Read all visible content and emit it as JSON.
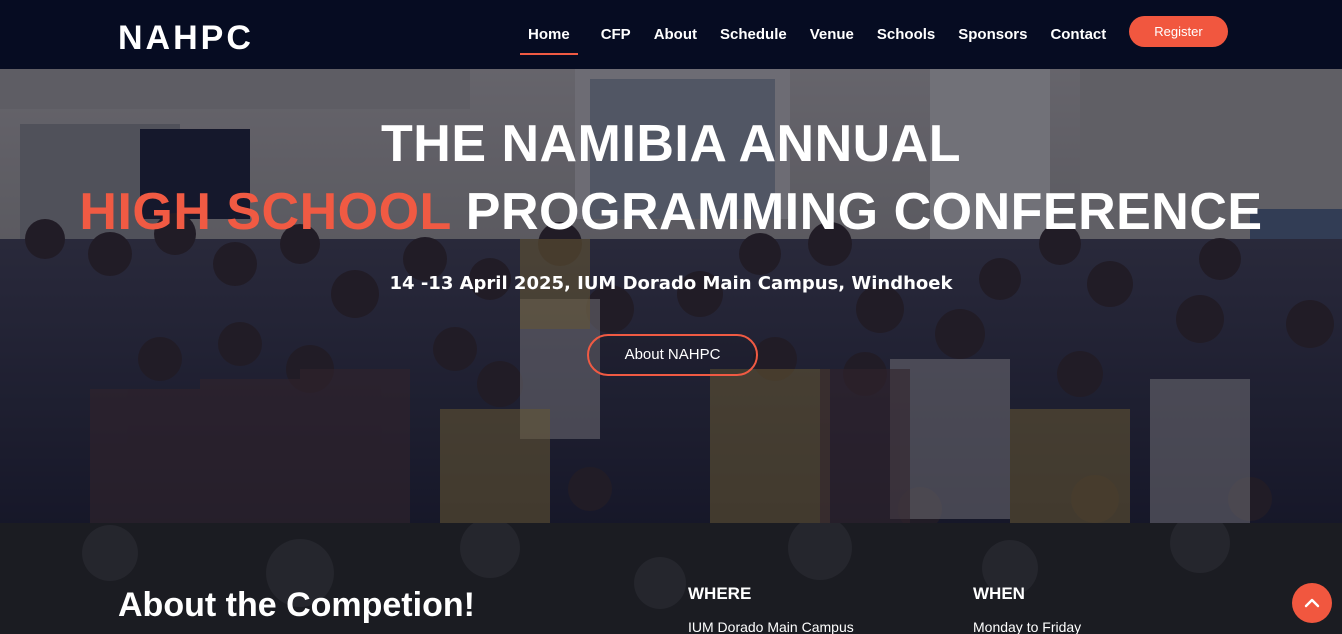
{
  "header": {
    "logo": "NAHPC",
    "nav": [
      {
        "label": "Home",
        "active": true
      },
      {
        "label": "CFP"
      },
      {
        "label": "About"
      },
      {
        "label": "Schedule"
      },
      {
        "label": "Venue"
      },
      {
        "label": "Schools"
      },
      {
        "label": "Sponsors"
      },
      {
        "label": "Contact"
      }
    ],
    "register_label": "Register"
  },
  "hero": {
    "title_line1": "THE NAMIBIA ANNUAL",
    "title_accent": "HIGH SCHOOL",
    "title_rest": " PROGRAMMING CONFERENCE",
    "subtitle": "14 -13 April 2025, IUM Dorado Main Campus, Windhoek",
    "button_label": "About NAHPC"
  },
  "about": {
    "heading": "About the Competion!",
    "where_label": "WHERE",
    "where_value": "IUM Dorado Main Campus",
    "when_label": "WHEN",
    "when_value": "Monday to Friday"
  },
  "colors": {
    "accent": "#f05a43",
    "header_bg": "#060c22",
    "section_bg": "#1a1b22"
  },
  "icons": {
    "scroll_top": "chevron-up-icon"
  }
}
